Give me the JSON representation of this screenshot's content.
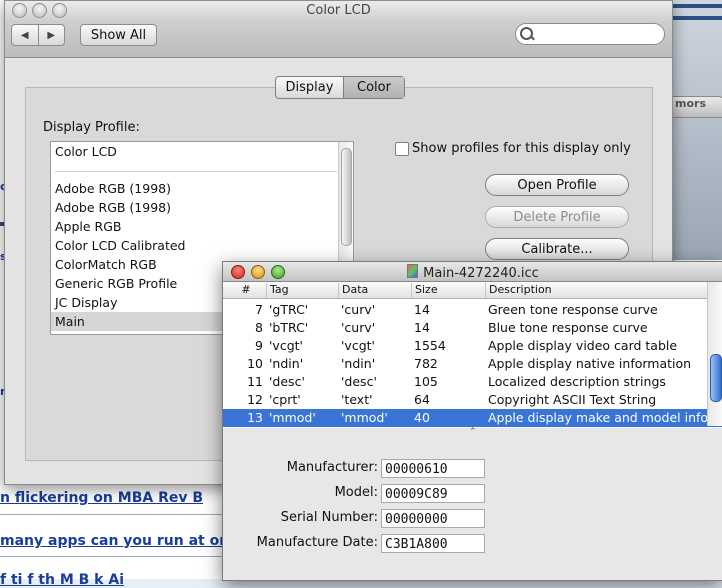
{
  "background": {
    "tab_label": "mors",
    "links": [
      "n flickering on MBA Rev B",
      "many apps can you run at once?",
      "f ti   f th M B k Ai"
    ]
  },
  "pref_window": {
    "title": "Color LCD",
    "nav": {
      "back": "◀",
      "forward": "▶"
    },
    "show_all": "Show All",
    "search_placeholder": "",
    "tabs": [
      "Display",
      "Color"
    ],
    "selected_tab": "Color",
    "display_profile_label": "Display Profile:",
    "profiles_top": [
      "Color LCD"
    ],
    "profiles": [
      "Adobe RGB (1998)",
      "Adobe RGB (1998)",
      "Apple RGB",
      "Color LCD Calibrated",
      "ColorMatch RGB",
      "Generic RGB Profile",
      "JC Display",
      "Main"
    ],
    "selected_profile": "Main",
    "checkbox_label": "Show profiles for this display only",
    "checkbox_checked": false,
    "buttons": {
      "open": "Open Profile",
      "delete": "Delete Profile",
      "calibrate": "Calibrate..."
    }
  },
  "icc_window": {
    "title": "Main-4272240.icc",
    "columns": [
      "#",
      "Tag",
      "Data",
      "Size",
      "Description"
    ],
    "rows": [
      {
        "num": "7",
        "tag": "'gTRC'",
        "data": "'curv'",
        "size": "14",
        "desc": "Green tone response curve"
      },
      {
        "num": "8",
        "tag": "'bTRC'",
        "data": "'curv'",
        "size": "14",
        "desc": "Blue tone response curve"
      },
      {
        "num": "9",
        "tag": "'vcgt'",
        "data": "'vcgt'",
        "size": "1554",
        "desc": "Apple display video card table"
      },
      {
        "num": "10",
        "tag": "'ndin'",
        "data": "'ndin'",
        "size": "782",
        "desc": "Apple display native information"
      },
      {
        "num": "11",
        "tag": "'desc'",
        "data": "'desc'",
        "size": "105",
        "desc": "Localized description strings"
      },
      {
        "num": "12",
        "tag": "'cprt'",
        "data": "'text'",
        "size": "64",
        "desc": "Copyright ASCII Text String"
      },
      {
        "num": "13",
        "tag": "'mmod'",
        "data": "'mmod'",
        "size": "40",
        "desc": "Apple display make and model inform"
      }
    ],
    "selected_row": "13",
    "fields": [
      {
        "label": "Manufacturer:",
        "value": "00000610"
      },
      {
        "label": "Model:",
        "value": "00009C89"
      },
      {
        "label": "Serial Number:",
        "value": "00000000"
      },
      {
        "label": "Manufacture Date:",
        "value": "C3B1A800"
      }
    ]
  },
  "colors": {
    "selection_blue": "#3875d7",
    "link_blue": "#1a3d9c"
  }
}
